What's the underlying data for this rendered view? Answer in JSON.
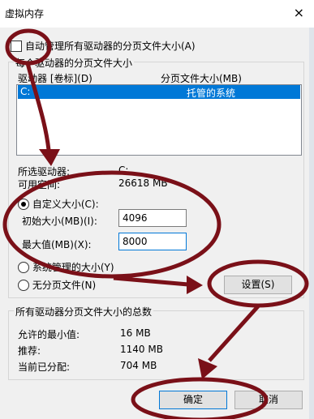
{
  "window": {
    "title": "虚拟内存",
    "close_icon": "×"
  },
  "auto_manage": {
    "label": "自动管理所有驱动器的分页文件大小(A)",
    "checked": false
  },
  "drive_group": {
    "title": "每个驱动器的分页文件大小",
    "col_drive": "驱动器 [卷标](D)",
    "col_size": "分页文件大小(MB)",
    "rows": [
      {
        "drive": "C:",
        "size": "托管的系统"
      }
    ],
    "selected_drive_label": "所选驱动器:",
    "selected_drive_value": "C:",
    "available_label": "可用空间:",
    "available_value": "26618 MB"
  },
  "custom": {
    "radio_label": "自定义大小(C):",
    "initial_label": "初始大小(MB)(I):",
    "initial_value": "4096",
    "max_label": "最大值(MB)(X):",
    "max_value": "8000",
    "system_managed_label": "系统管理的大小(Y)",
    "no_paging_label": "无分页文件(N)",
    "set_button": "设置(S)"
  },
  "totals": {
    "title": "所有驱动器分页文件大小的总数",
    "min_label": "允许的最小值:",
    "min_value": "16 MB",
    "recommended_label": "推荐:",
    "recommended_value": "1140 MB",
    "allocated_label": "当前已分配:",
    "allocated_value": "704 MB"
  },
  "footer": {
    "ok_button": "确定",
    "cancel_button": "取消"
  },
  "annotation_color": "#7a1018"
}
